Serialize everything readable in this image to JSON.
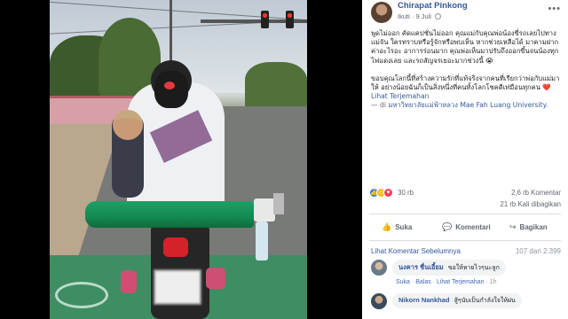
{
  "post": {
    "author": "Chirapat Pinkong",
    "follow": "Ikuti",
    "date": "9 Juli",
    "more_icon": "more-dots-icon",
    "paragraph1": "พูดไม่ออก คัดแคปชั่นไม่ออก คุณแม่กับคุณพ่อน้องขี่รถเลยไปทางแม่จัน ใครทราบหรือรู้จักหรือพบเห็น หากช่วยเหลือได้ มาคามฝากค่าอะไรอะ อาการร่อนมาก คุณพ่อเห็นมาปรับถึงออกขี้นจนน้องทุกไฟแดงเลย และรถสัญจรเยอะมากช่วงนี้ 😭",
    "paragraph2": "ขอบคุณโลกนี้ที่สร้างความรักที่แท้จริงจากคนที่เรียกว่าพ่อกับแม่มาให้ อย่างน้อยฉันก็เป็นสิ่งหนึ่งที่คนทั้งโลกโชคดีเท่มือนทุกคน",
    "heart": "❤️",
    "translate": "Lihat Terjemahan",
    "location_prefix": "— di",
    "location": "มหาวิทยาลัยแม่ฟ้าหลวง Mae Fah Luang University",
    "location_suffix": "."
  },
  "stats": {
    "reactions": "30 rb",
    "comments": "2,6 rb Komentar",
    "shares": "21 rb Kali dibagikan"
  },
  "actions": {
    "like": "Suka",
    "comment": "Komentari",
    "share": "Bagikan"
  },
  "comments_section": {
    "previous": "Lihat Komentar Sebelumnya",
    "count": "107 dari 2.399",
    "items": [
      {
        "name": "นงคาร ชื่นเอี้ยม",
        "text": "ขอให้หายไวๆนะลูก",
        "like": "Suka",
        "reply": "Balas",
        "translate": "Lihat Terjemahan",
        "time": "1h"
      },
      {
        "name": "Nikorn Nankhad",
        "text": "สู้ๆนับเป็นกำลังใจให้ฝน"
      }
    ]
  },
  "colors": {
    "link": "#365899",
    "accent": "#4267b2",
    "like_blue": "#2078f4",
    "love_red": "#f33e58",
    "haha_yellow": "#f7b928",
    "oxygen_tank": "#138a50"
  }
}
